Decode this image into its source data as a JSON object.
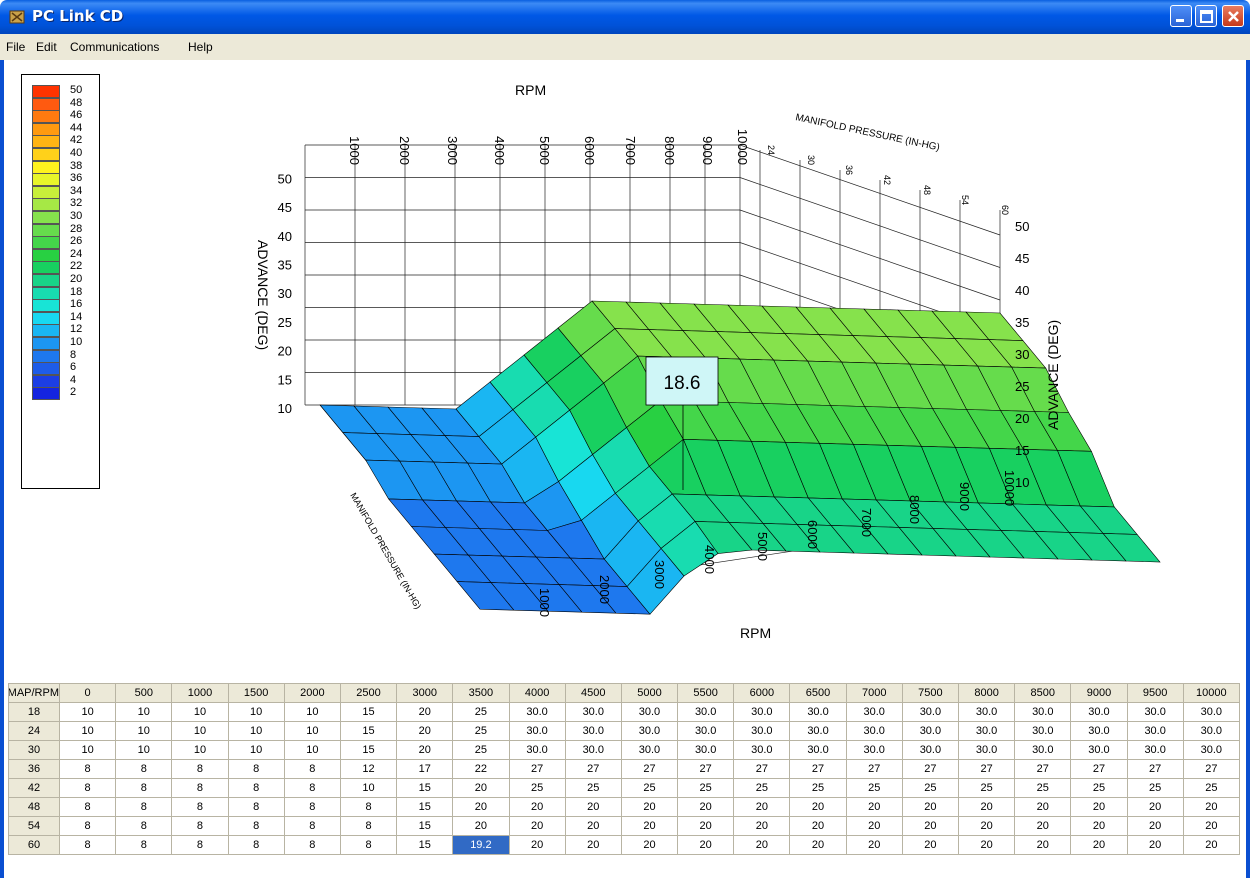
{
  "window": {
    "title": "PC Link CD"
  },
  "menu": [
    "File",
    "Edit",
    "Communications",
    "Help"
  ],
  "legend": [
    {
      "value": "50",
      "color": "#ff3300"
    },
    {
      "value": "48",
      "color": "#ff5a10"
    },
    {
      "value": "46",
      "color": "#ff7a10"
    },
    {
      "value": "44",
      "color": "#ff9a10"
    },
    {
      "value": "42",
      "color": "#ffb414"
    },
    {
      "value": "40",
      "color": "#ffd11a"
    },
    {
      "value": "38",
      "color": "#fff21e"
    },
    {
      "value": "36",
      "color": "#e8f52a"
    },
    {
      "value": "34",
      "color": "#c8ef3a"
    },
    {
      "value": "32",
      "color": "#a6e845"
    },
    {
      "value": "30",
      "color": "#86e24c"
    },
    {
      "value": "28",
      "color": "#66dc4c"
    },
    {
      "value": "26",
      "color": "#44d64a"
    },
    {
      "value": "24",
      "color": "#28d042"
    },
    {
      "value": "22",
      "color": "#18d060"
    },
    {
      "value": "20",
      "color": "#18d488"
    },
    {
      "value": "18",
      "color": "#18dcb0"
    },
    {
      "value": "16",
      "color": "#18e4d6"
    },
    {
      "value": "14",
      "color": "#18d8f0"
    },
    {
      "value": "12",
      "color": "#1ab6f2"
    },
    {
      "value": "10",
      "color": "#1c96f2"
    },
    {
      "value": "8",
      "color": "#1e78ee"
    },
    {
      "value": "6",
      "color": "#1e5ce8"
    },
    {
      "value": "4",
      "color": "#1c3ee4"
    },
    {
      "value": "2",
      "color": "#1424e0"
    }
  ],
  "chart_data": {
    "type": "surface3d",
    "x_label": "RPM",
    "y_label": "MANIFOLD PRESSURE (IN-HG)",
    "z_label": "ADVANCE (DEG)",
    "rpm_ticks": [
      "1000",
      "2000",
      "3000",
      "4000",
      "5000",
      "6000",
      "7000",
      "8000",
      "9000",
      "10000"
    ],
    "map_ticks": [
      "24",
      "30",
      "36",
      "42",
      "48",
      "54",
      "60"
    ],
    "z_ticks_left": [
      "10",
      "15",
      "20",
      "25",
      "30",
      "35",
      "40",
      "45",
      "50"
    ],
    "z_ticks_right": [
      "10",
      "15",
      "20",
      "25",
      "30",
      "35",
      "40",
      "45",
      "50"
    ],
    "cursor_value": "18.6",
    "rpm": [
      0,
      500,
      1000,
      1500,
      2000,
      2500,
      3000,
      3500,
      4000,
      4500,
      5000,
      5500,
      6000,
      6500,
      7000,
      7500,
      8000,
      8500,
      9000,
      9500,
      10000
    ],
    "map": [
      18,
      24,
      30,
      36,
      42,
      48,
      54,
      60
    ],
    "advance": [
      [
        10,
        10,
        10,
        10,
        10,
        15,
        20,
        25,
        30,
        30,
        30,
        30,
        30,
        30,
        30,
        30,
        30,
        30,
        30,
        30,
        30
      ],
      [
        10,
        10,
        10,
        10,
        10,
        15,
        20,
        25,
        30,
        30,
        30,
        30,
        30,
        30,
        30,
        30,
        30,
        30,
        30,
        30,
        30
      ],
      [
        10,
        10,
        10,
        10,
        10,
        15,
        20,
        25,
        30,
        30,
        30,
        30,
        30,
        30,
        30,
        30,
        30,
        30,
        30,
        30,
        30
      ],
      [
        8,
        8,
        8,
        8,
        8,
        12,
        17,
        22,
        27,
        27,
        27,
        27,
        27,
        27,
        27,
        27,
        27,
        27,
        27,
        27,
        27
      ],
      [
        8,
        8,
        8,
        8,
        8,
        10,
        15,
        20,
        25,
        25,
        25,
        25,
        25,
        25,
        25,
        25,
        25,
        25,
        25,
        25,
        25
      ],
      [
        8,
        8,
        8,
        8,
        8,
        8,
        15,
        20,
        20,
        20,
        20,
        20,
        20,
        20,
        20,
        20,
        20,
        20,
        20,
        20,
        20
      ],
      [
        8,
        8,
        8,
        8,
        8,
        8,
        15,
        20,
        20,
        20,
        20,
        20,
        20,
        20,
        20,
        20,
        20,
        20,
        20,
        20,
        20
      ],
      [
        8,
        8,
        8,
        8,
        8,
        8,
        15,
        19.2,
        20,
        20,
        20,
        20,
        20,
        20,
        20,
        20,
        20,
        20,
        20,
        20,
        20
      ]
    ]
  },
  "table": {
    "corner": "MAP/RPM",
    "columns": [
      "0",
      "500",
      "1000",
      "1500",
      "2000",
      "2500",
      "3000",
      "3500",
      "4000",
      "4500",
      "5000",
      "5500",
      "6000",
      "6500",
      "7000",
      "7500",
      "8000",
      "8500",
      "9000",
      "9500",
      "10000"
    ],
    "rows": [
      {
        "label": "18",
        "cells": [
          "10",
          "10",
          "10",
          "10",
          "10",
          "15",
          "20",
          "25",
          "30.0",
          "30.0",
          "30.0",
          "30.0",
          "30.0",
          "30.0",
          "30.0",
          "30.0",
          "30.0",
          "30.0",
          "30.0",
          "30.0",
          "30.0"
        ]
      },
      {
        "label": "24",
        "cells": [
          "10",
          "10",
          "10",
          "10",
          "10",
          "15",
          "20",
          "25",
          "30.0",
          "30.0",
          "30.0",
          "30.0",
          "30.0",
          "30.0",
          "30.0",
          "30.0",
          "30.0",
          "30.0",
          "30.0",
          "30.0",
          "30.0"
        ]
      },
      {
        "label": "30",
        "cells": [
          "10",
          "10",
          "10",
          "10",
          "10",
          "15",
          "20",
          "25",
          "30.0",
          "30.0",
          "30.0",
          "30.0",
          "30.0",
          "30.0",
          "30.0",
          "30.0",
          "30.0",
          "30.0",
          "30.0",
          "30.0",
          "30.0"
        ]
      },
      {
        "label": "36",
        "cells": [
          "8",
          "8",
          "8",
          "8",
          "8",
          "12",
          "17",
          "22",
          "27",
          "27",
          "27",
          "27",
          "27",
          "27",
          "27",
          "27",
          "27",
          "27",
          "27",
          "27",
          "27"
        ]
      },
      {
        "label": "42",
        "cells": [
          "8",
          "8",
          "8",
          "8",
          "8",
          "10",
          "15",
          "20",
          "25",
          "25",
          "25",
          "25",
          "25",
          "25",
          "25",
          "25",
          "25",
          "25",
          "25",
          "25",
          "25"
        ]
      },
      {
        "label": "48",
        "cells": [
          "8",
          "8",
          "8",
          "8",
          "8",
          "8",
          "15",
          "20",
          "20",
          "20",
          "20",
          "20",
          "20",
          "20",
          "20",
          "20",
          "20",
          "20",
          "20",
          "20",
          "20"
        ]
      },
      {
        "label": "54",
        "cells": [
          "8",
          "8",
          "8",
          "8",
          "8",
          "8",
          "15",
          "20",
          "20",
          "20",
          "20",
          "20",
          "20",
          "20",
          "20",
          "20",
          "20",
          "20",
          "20",
          "20",
          "20"
        ]
      },
      {
        "label": "60",
        "cells": [
          "8",
          "8",
          "8",
          "8",
          "8",
          "8",
          "15",
          "19.2",
          "20",
          "20",
          "20",
          "20",
          "20",
          "20",
          "20",
          "20",
          "20",
          "20",
          "20",
          "20",
          "20"
        ]
      }
    ],
    "selected": {
      "row": "60",
      "column": "3500"
    }
  }
}
